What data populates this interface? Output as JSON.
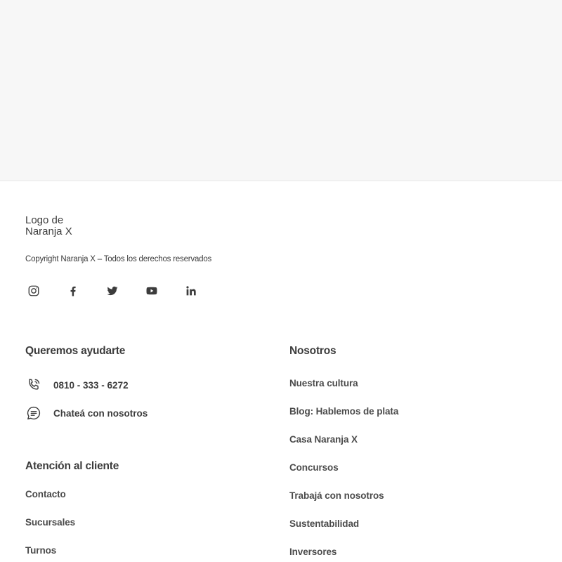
{
  "logo": {
    "alt": "Logo de Naranja X"
  },
  "copyright": "Copyright Naranja X – Todos los derechos reservados",
  "social": [
    {
      "icon": "instagram-icon"
    },
    {
      "icon": "facebook-icon"
    },
    {
      "icon": "twitter-icon"
    },
    {
      "icon": "youtube-icon"
    },
    {
      "icon": "linkedin-icon"
    }
  ],
  "help": {
    "heading": "Queremos ayudarte",
    "phone": "0810 - 333 - 6272",
    "chat": "Chateá con nosotros"
  },
  "customer": {
    "heading": "Atención al cliente",
    "links": [
      "Contacto",
      "Sucursales",
      "Turnos"
    ]
  },
  "about": {
    "heading": "Nosotros",
    "links": [
      "Nuestra cultura",
      "Blog: Hablemos de plata",
      "Casa Naranja X",
      "Concursos",
      "Trabajá con nosotros",
      "Sustentabilidad",
      "Inversores"
    ]
  },
  "colors": {
    "text": "#3c3c3c",
    "top_background": "#f7f7f7"
  }
}
